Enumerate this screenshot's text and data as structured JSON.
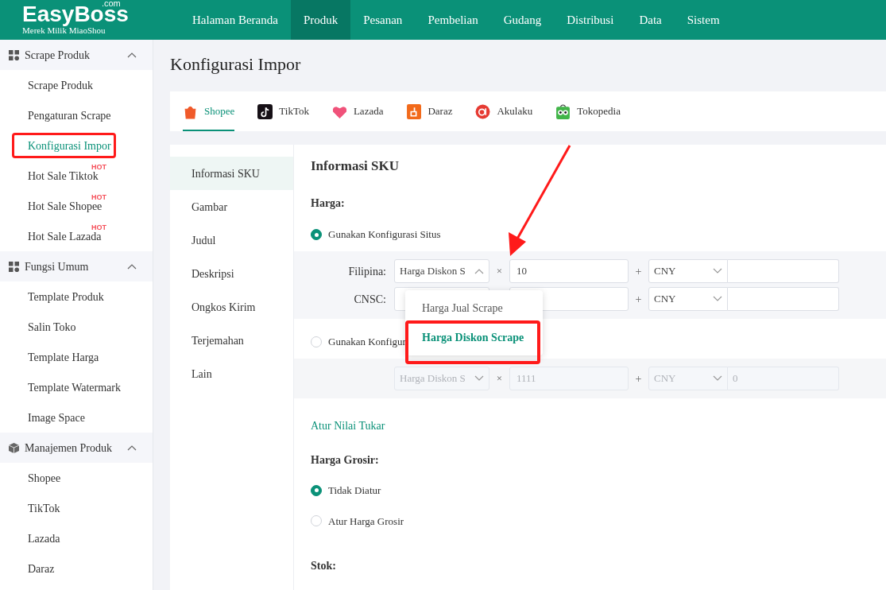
{
  "header": {
    "logo": "EasyBoss",
    "logo_suffix": ".com",
    "tagline": "Merek Milik MiaoShou",
    "nav": [
      {
        "label": "Halaman Beranda",
        "selected": false
      },
      {
        "label": "Produk",
        "selected": true
      },
      {
        "label": "Pesanan",
        "selected": false
      },
      {
        "label": "Pembelian",
        "selected": false
      },
      {
        "label": "Gudang",
        "selected": false
      },
      {
        "label": "Distribusi",
        "selected": false
      },
      {
        "label": "Data",
        "selected": false
      },
      {
        "label": "Sistem",
        "selected": false
      }
    ]
  },
  "sidebar": [
    {
      "label": "Scrape Produk",
      "kind": "grid",
      "expanded": true,
      "children": [
        {
          "label": "Scrape Produk",
          "selected": false,
          "annotated": false
        },
        {
          "label": "Pengaturan Scrape",
          "selected": false,
          "annotated": false
        },
        {
          "label": "Konfigurasi Impor",
          "selected": true,
          "annotated": true
        },
        {
          "label": "Hot Sale Tiktok",
          "badge": "HOT",
          "selected": false,
          "annotated": false
        },
        {
          "label": "Hot Sale Shopee",
          "badge": "HOT",
          "selected": false,
          "annotated": false
        },
        {
          "label": "Hot Sale Lazada",
          "badge": "HOT",
          "selected": false,
          "annotated": false
        }
      ]
    },
    {
      "label": "Fungsi Umum",
      "kind": "grid",
      "expanded": true,
      "children": [
        {
          "label": "Template Produk",
          "selected": false,
          "annotated": false
        },
        {
          "label": "Salin Toko",
          "selected": false,
          "annotated": false
        },
        {
          "label": "Template Harga",
          "selected": false,
          "annotated": false
        },
        {
          "label": "Template Watermark",
          "selected": false,
          "annotated": false
        },
        {
          "label": "Image Space",
          "selected": false,
          "annotated": false
        }
      ]
    },
    {
      "label": "Manajemen Produk",
      "kind": "box",
      "expanded": true,
      "children": [
        {
          "label": "Shopee",
          "selected": false,
          "annotated": false
        },
        {
          "label": "TikTok",
          "selected": false,
          "annotated": false
        },
        {
          "label": "Lazada",
          "selected": false,
          "annotated": false
        },
        {
          "label": "Daraz",
          "selected": false,
          "annotated": false
        }
      ]
    }
  ],
  "page_title": "Konfigurasi Impor",
  "platform_tabs": [
    {
      "label": "Shopee",
      "color": "#f05a2a",
      "selected": true
    },
    {
      "label": "TikTok",
      "color": "#161016",
      "selected": false
    },
    {
      "label": "Lazada",
      "color": "#f0527a",
      "selected": false
    },
    {
      "label": "Daraz",
      "color": "#f26a1b",
      "selected": false
    },
    {
      "label": "Akulaku",
      "color": "#e63a32",
      "selected": false
    },
    {
      "label": "Tokopedia",
      "color": "#42b549",
      "selected": false
    }
  ],
  "section_menu": [
    {
      "label": "Informasi SKU",
      "selected": true
    },
    {
      "label": "Gambar",
      "selected": false
    },
    {
      "label": "Judul",
      "selected": false
    },
    {
      "label": "Deskripsi",
      "selected": false
    },
    {
      "label": "Ongkos Kirim",
      "selected": false
    },
    {
      "label": "Terjemahan",
      "selected": false
    },
    {
      "label": "Lain",
      "selected": false
    }
  ],
  "section_title": "Informasi SKU",
  "price_label": "Harga:",
  "price_options": [
    {
      "label": "Gunakan Konfigurasi Situs",
      "selected": true,
      "disabled": false,
      "rows": [
        {
          "label": "Filipina:",
          "source": "Harga Diskon S",
          "source_open": true,
          "times": "×",
          "multiplier": "10",
          "plus": "+",
          "currency": "CNY",
          "addend": ""
        },
        {
          "label": "CNSC:",
          "plus": "+",
          "currency": "CNY",
          "addend": ""
        }
      ]
    },
    {
      "label": "Gunakan Konfigur",
      "selected": false,
      "disabled": true,
      "rows": [
        {
          "source": "Harga Diskon S",
          "source_open": false,
          "times": "×",
          "multiplier": "1111",
          "plus": "+",
          "currency": "CNY",
          "addend": "0"
        }
      ]
    }
  ],
  "dropdown": [
    {
      "label": "Harga Jual Scrape",
      "selected": false,
      "annotated": false
    },
    {
      "label": "Harga Diskon Scrape",
      "selected": true,
      "annotated": true
    }
  ],
  "exchange_link": "Atur Nilai Tukar",
  "wholesale_label": "Harga Grosir:",
  "wholesale_options": [
    {
      "label": "Tidak Diatur",
      "selected": true
    },
    {
      "label": "Atur Harga Grosir",
      "selected": false
    }
  ],
  "stock_label": "Stok:"
}
